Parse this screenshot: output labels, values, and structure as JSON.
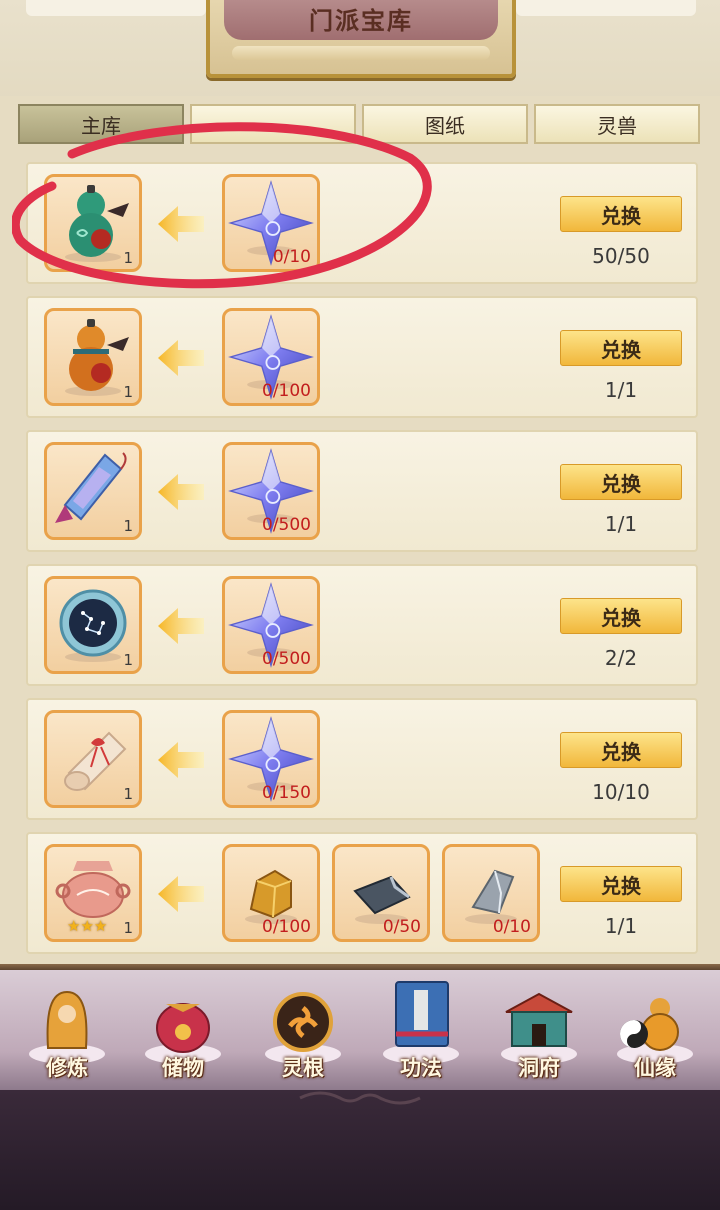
{
  "header": {
    "title": "门派宝库"
  },
  "tabs": [
    {
      "label": "主库",
      "active": true
    },
    {
      "label": "",
      "active": false
    },
    {
      "label": "图纸",
      "active": false
    },
    {
      "label": "灵兽",
      "active": false
    }
  ],
  "items": [
    {
      "reward": "jade-gourd-icon",
      "reward_qty": "1",
      "costs": [
        {
          "icon": "star-crystal-icon",
          "need": "0/10"
        }
      ],
      "button": "兑换",
      "limit": "50/50"
    },
    {
      "reward": "orange-gourd-icon",
      "reward_qty": "1",
      "costs": [
        {
          "icon": "star-crystal-icon",
          "need": "0/100"
        }
      ],
      "button": "兑换",
      "limit": "1/1"
    },
    {
      "reward": "crystal-talisman-icon",
      "reward_qty": "1",
      "costs": [
        {
          "icon": "star-crystal-icon",
          "need": "0/500"
        }
      ],
      "button": "兑换",
      "limit": "1/1"
    },
    {
      "reward": "star-disc-icon",
      "reward_qty": "1",
      "costs": [
        {
          "icon": "star-crystal-icon",
          "need": "0/500"
        }
      ],
      "button": "兑换",
      "limit": "2/2"
    },
    {
      "reward": "scroll-icon",
      "reward_qty": "1",
      "costs": [
        {
          "icon": "star-crystal-icon",
          "need": "0/150"
        }
      ],
      "button": "兑换",
      "limit": "10/10"
    },
    {
      "reward": "incense-burner-icon",
      "reward_qty": "1",
      "reward_stars": 3,
      "costs": [
        {
          "icon": "gold-ore-icon",
          "need": "0/100"
        },
        {
          "icon": "dark-iron-icon",
          "need": "0/50"
        },
        {
          "icon": "silver-stone-icon",
          "need": "0/10"
        }
      ],
      "button": "兑换",
      "limit": "1/1"
    }
  ],
  "nav": [
    {
      "label": "修炼",
      "icon": "cultivate-icon"
    },
    {
      "label": "储物",
      "icon": "storage-bag-icon"
    },
    {
      "label": "灵根",
      "icon": "spirit-root-icon"
    },
    {
      "label": "功法",
      "icon": "technique-book-icon"
    },
    {
      "label": "洞府",
      "icon": "cave-house-icon"
    },
    {
      "label": "仙缘",
      "icon": "immortal-fate-icon"
    }
  ],
  "colors": {
    "accent_button": "#f1b73b",
    "need_text": "#c21e1e",
    "circle_mark": "#e0304a"
  }
}
